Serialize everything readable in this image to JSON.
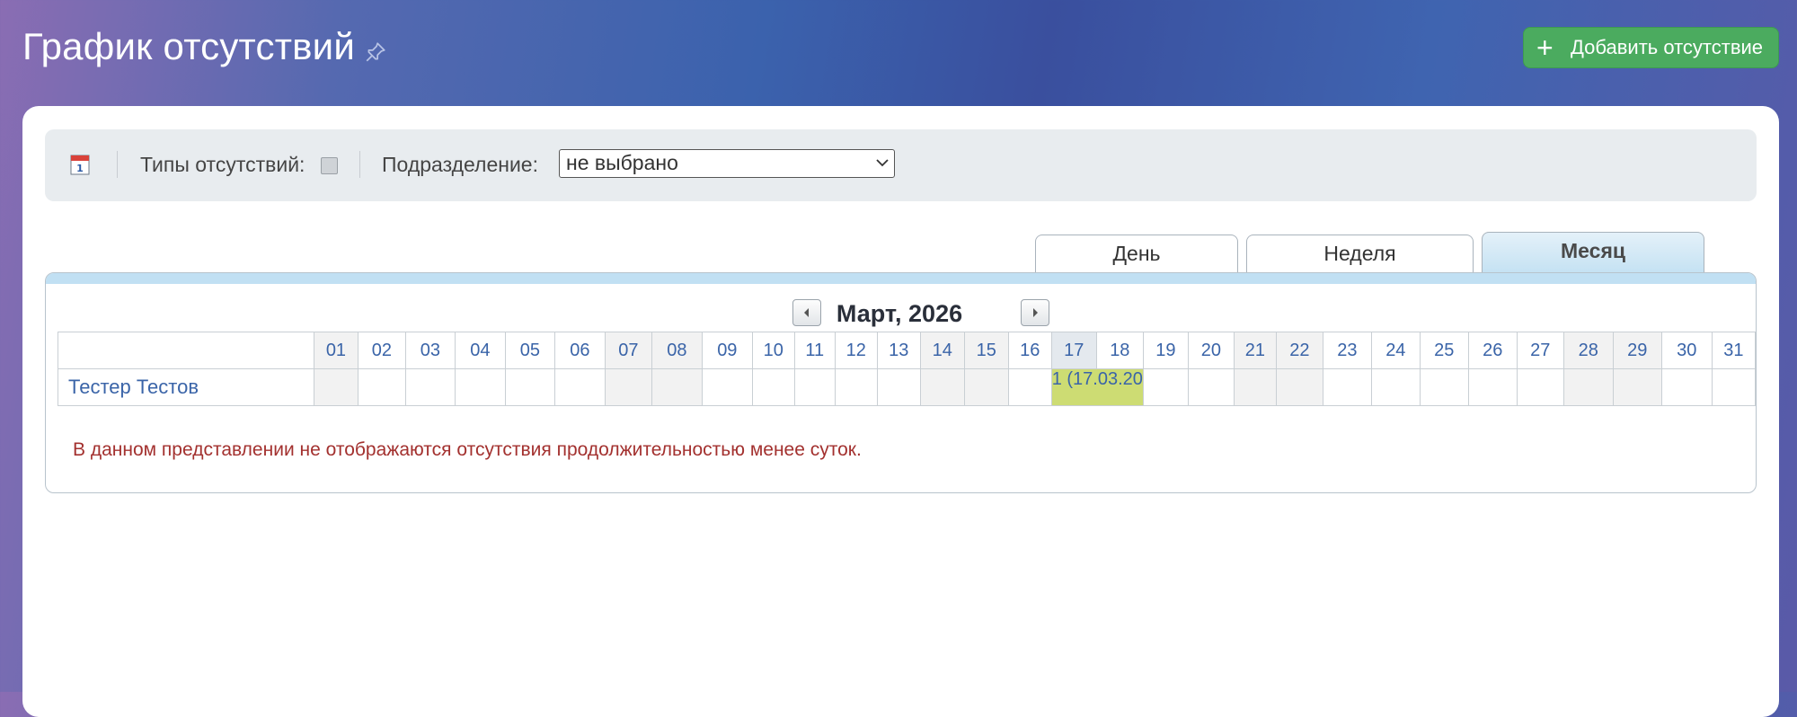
{
  "page": {
    "title": "График отсутствий",
    "add_button_label": "Добавить отсутствие"
  },
  "toolbar": {
    "types_label": "Типы отсутствий:",
    "department_label": "Подразделение:",
    "department_value": "не выбрано"
  },
  "tabs": [
    {
      "label": "День"
    },
    {
      "label": "Неделя"
    },
    {
      "label": "Месяц",
      "active": true
    }
  ],
  "calendar": {
    "month_title": "Март, 2026",
    "days": [
      "01",
      "02",
      "03",
      "04",
      "05",
      "06",
      "07",
      "08",
      "09",
      "10",
      "11",
      "12",
      "13",
      "14",
      "15",
      "16",
      "17",
      "18",
      "19",
      "20",
      "21",
      "22",
      "23",
      "24",
      "25",
      "26",
      "27",
      "28",
      "29",
      "30",
      "31"
    ],
    "weekend_days": [
      "01",
      "07",
      "08",
      "14",
      "15",
      "21",
      "22",
      "28",
      "29"
    ],
    "today": "17",
    "rows": [
      {
        "name": "Тестер Тестов",
        "event": {
          "label": "1 (17.03.20",
          "start_day": "17",
          "end_day": "18"
        }
      }
    ]
  },
  "note": "В данном представлении не отображаются отсутствия продолжительностью менее суток.",
  "colors": {
    "accent_green": "#4bab5f",
    "event_fill": "#cddc73",
    "link_blue": "#3a64a8",
    "note_red": "#a3312f"
  }
}
